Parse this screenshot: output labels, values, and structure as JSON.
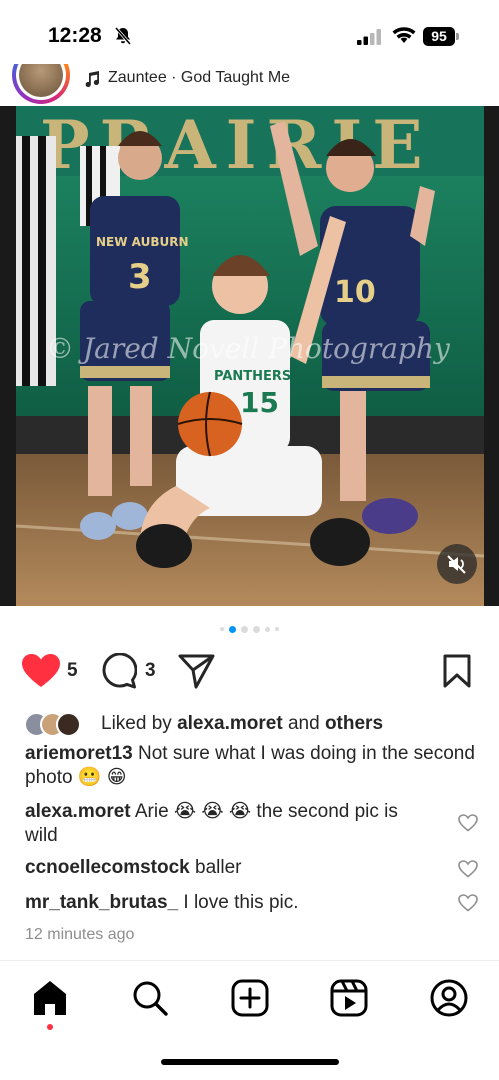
{
  "status_bar": {
    "time": "12:28",
    "battery": "95"
  },
  "post_header": {
    "music": "Zauntee · God Taught Me"
  },
  "photo": {
    "description_icon": "basketball-photo",
    "watermark": "© Jared Novell Photography",
    "banner_text": "PRAIRIE",
    "player_front_team": "PANTHERS",
    "player_front_number": "15",
    "player_left_team": "NEW AUBURN",
    "player_left_number": "3",
    "player_right_number": "10"
  },
  "carousel": {
    "count": 6,
    "active_index": 1
  },
  "actions": {
    "likes": "5",
    "comments": "3"
  },
  "liked_by": {
    "prefix": "Liked by",
    "user": "alexa.moret",
    "joiner": "and",
    "others": "others"
  },
  "caption": {
    "username": "ariemoret13",
    "text": "Not sure what I was doing in the second photo 😬 😁"
  },
  "comments": [
    {
      "username": "alexa.moret",
      "text": "Arie 😭 😭 😭  the second pic is wild"
    },
    {
      "username": "ccnoellecomstock",
      "text": "baller"
    },
    {
      "username": "mr_tank_brutas_",
      "text": "I love this pic."
    }
  ],
  "timestamp": "12 minutes ago",
  "colors": {
    "like_red": "#ff3040",
    "active_dot": "#0095f6",
    "muted_text": "#8e8e8e"
  }
}
